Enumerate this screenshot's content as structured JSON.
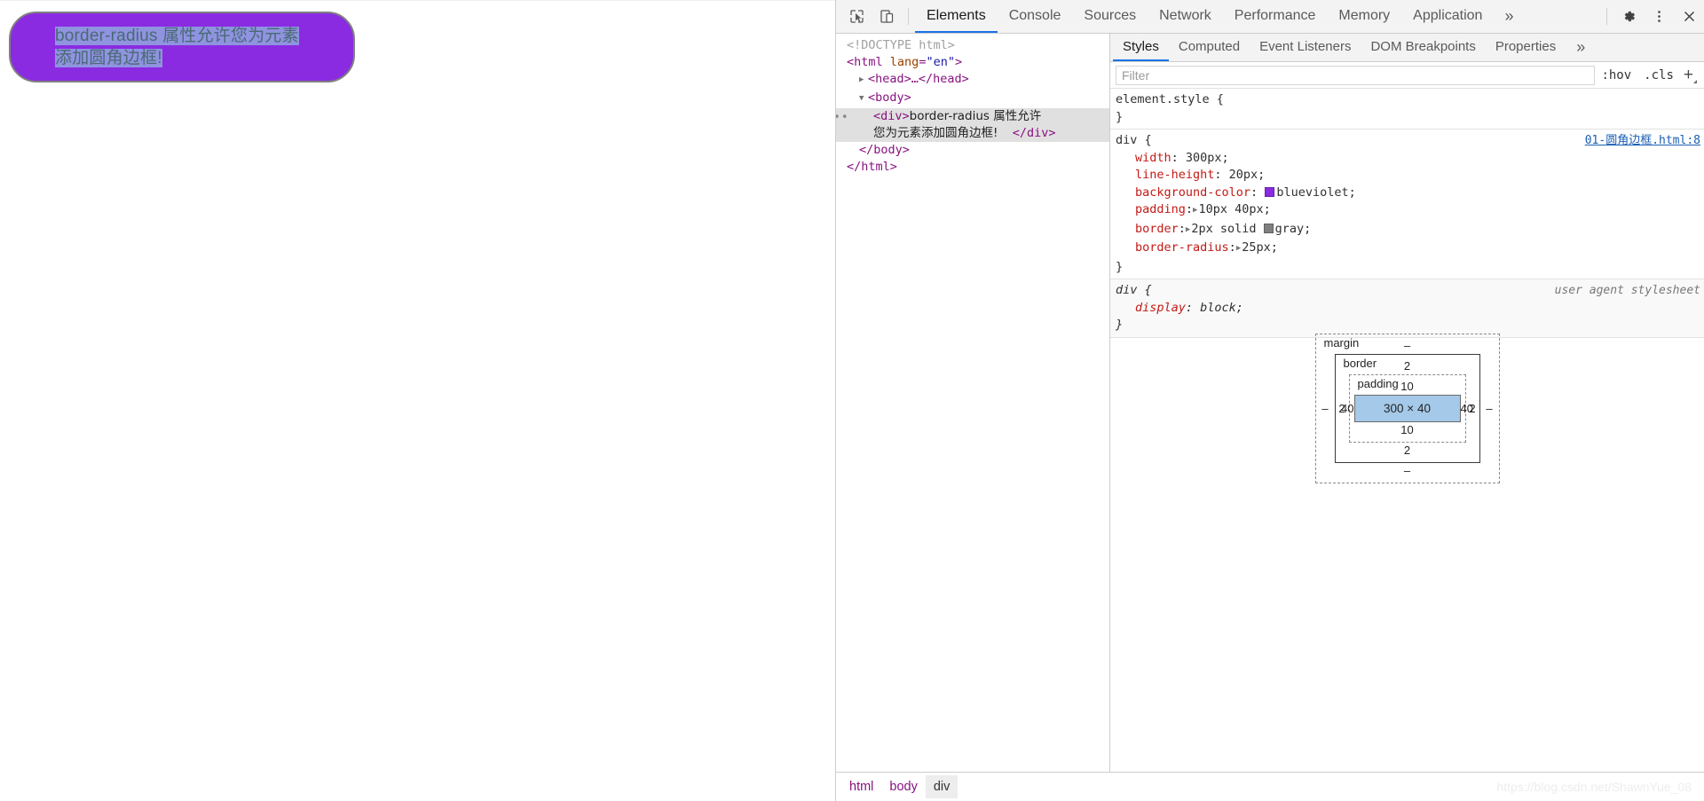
{
  "page": {
    "div_text_line1": "border-radius 属性允许您为元素添加圆",
    "div_text_line2": "角边框!",
    "div_full_text": "border-radius 属性允许您为元素添加圆角边框!",
    "background_color": "#8a2be2",
    "border_color": "#808080",
    "selection_color": "#8f93e0"
  },
  "devtools": {
    "toolbar": {
      "inspect_icon": "cursor-inspect-icon",
      "device_icon": "device-toolbar-icon",
      "tabs": [
        {
          "label": "Elements",
          "active": true
        },
        {
          "label": "Console",
          "active": false
        },
        {
          "label": "Sources",
          "active": false
        },
        {
          "label": "Network",
          "active": false
        },
        {
          "label": "Performance",
          "active": false
        },
        {
          "label": "Memory",
          "active": false
        },
        {
          "label": "Application",
          "active": false
        }
      ],
      "more_tabs": "»",
      "settings_icon": "gear-icon",
      "menu_icon": "kebab-menu-icon",
      "close_icon": "close-icon"
    },
    "dom": {
      "rows": [
        {
          "kind": "doctype",
          "text": "<!DOCTYPE html>"
        },
        {
          "kind": "open_html",
          "tag": "html",
          "attr": "lang",
          "value": "\"en\""
        },
        {
          "kind": "collapsed",
          "text": "<head>…</head>"
        },
        {
          "kind": "open",
          "text": "<body>"
        },
        {
          "kind": "selected",
          "open_tag": "<div>",
          "text_part1": "border-radius 属性允许",
          "text_part2": "您为元素添加圆角边框!",
          "close_tag": "</div>"
        },
        {
          "kind": "close",
          "text": "</body>"
        },
        {
          "kind": "close",
          "text": "</html>"
        }
      ]
    },
    "styles": {
      "tabs": [
        {
          "label": "Styles",
          "active": true
        },
        {
          "label": "Computed",
          "active": false
        },
        {
          "label": "Event Listeners",
          "active": false
        },
        {
          "label": "DOM Breakpoints",
          "active": false
        },
        {
          "label": "Properties",
          "active": false
        }
      ],
      "more_tabs": "»",
      "filter_placeholder": "Filter",
      "filter_value": "",
      "hov_button": ":hov",
      "cls_button": ".cls",
      "new_rule_button": "+",
      "rules": [
        {
          "selector": "element.style {",
          "close": "}",
          "origin": "",
          "origin_is_link": false,
          "declarations": []
        },
        {
          "selector": "div {",
          "close": "}",
          "origin": "01-圆角边框.html:8",
          "origin_is_link": true,
          "declarations": [
            {
              "prop": "width",
              "value": "300px;",
              "expandable": false,
              "swatch": ""
            },
            {
              "prop": "line-height",
              "value": "20px;",
              "expandable": false,
              "swatch": ""
            },
            {
              "prop": "background-color",
              "value": "blueviolet;",
              "expandable": false,
              "swatch": "#8a2be2"
            },
            {
              "prop": "padding",
              "value": "10px 40px;",
              "expandable": true,
              "swatch": ""
            },
            {
              "prop": "border",
              "value": "2px solid gray;",
              "expandable": true,
              "swatch": "#808080",
              "swatch_before": "gray;"
            },
            {
              "prop": "border-radius",
              "value": "25px;",
              "expandable": true,
              "swatch": ""
            }
          ]
        },
        {
          "selector": "div {",
          "close": "}",
          "origin": "user agent stylesheet",
          "origin_is_link": false,
          "declarations": [
            {
              "prop": "display",
              "value": "block;",
              "expandable": false,
              "swatch": ""
            }
          ]
        }
      ]
    },
    "box_model": {
      "margin_label": "margin",
      "border_label": "border",
      "padding_label": "padding",
      "margin_top": "–",
      "margin_right": "–",
      "margin_bottom": "–",
      "margin_left": "–",
      "border_top": "2",
      "border_right": "2",
      "border_bottom": "2",
      "border_left": "2",
      "padding_top": "10",
      "padding_right": "40",
      "padding_bottom": "10",
      "padding_left": "40",
      "content_size": "300 × 40",
      "content_color": "#a5c9e8"
    },
    "breadcrumb": [
      {
        "label": "html",
        "active": false
      },
      {
        "label": "body",
        "active": false
      },
      {
        "label": "div",
        "active": true
      }
    ]
  },
  "watermark": "https://blog.csdn.net/ShawnYue_08"
}
